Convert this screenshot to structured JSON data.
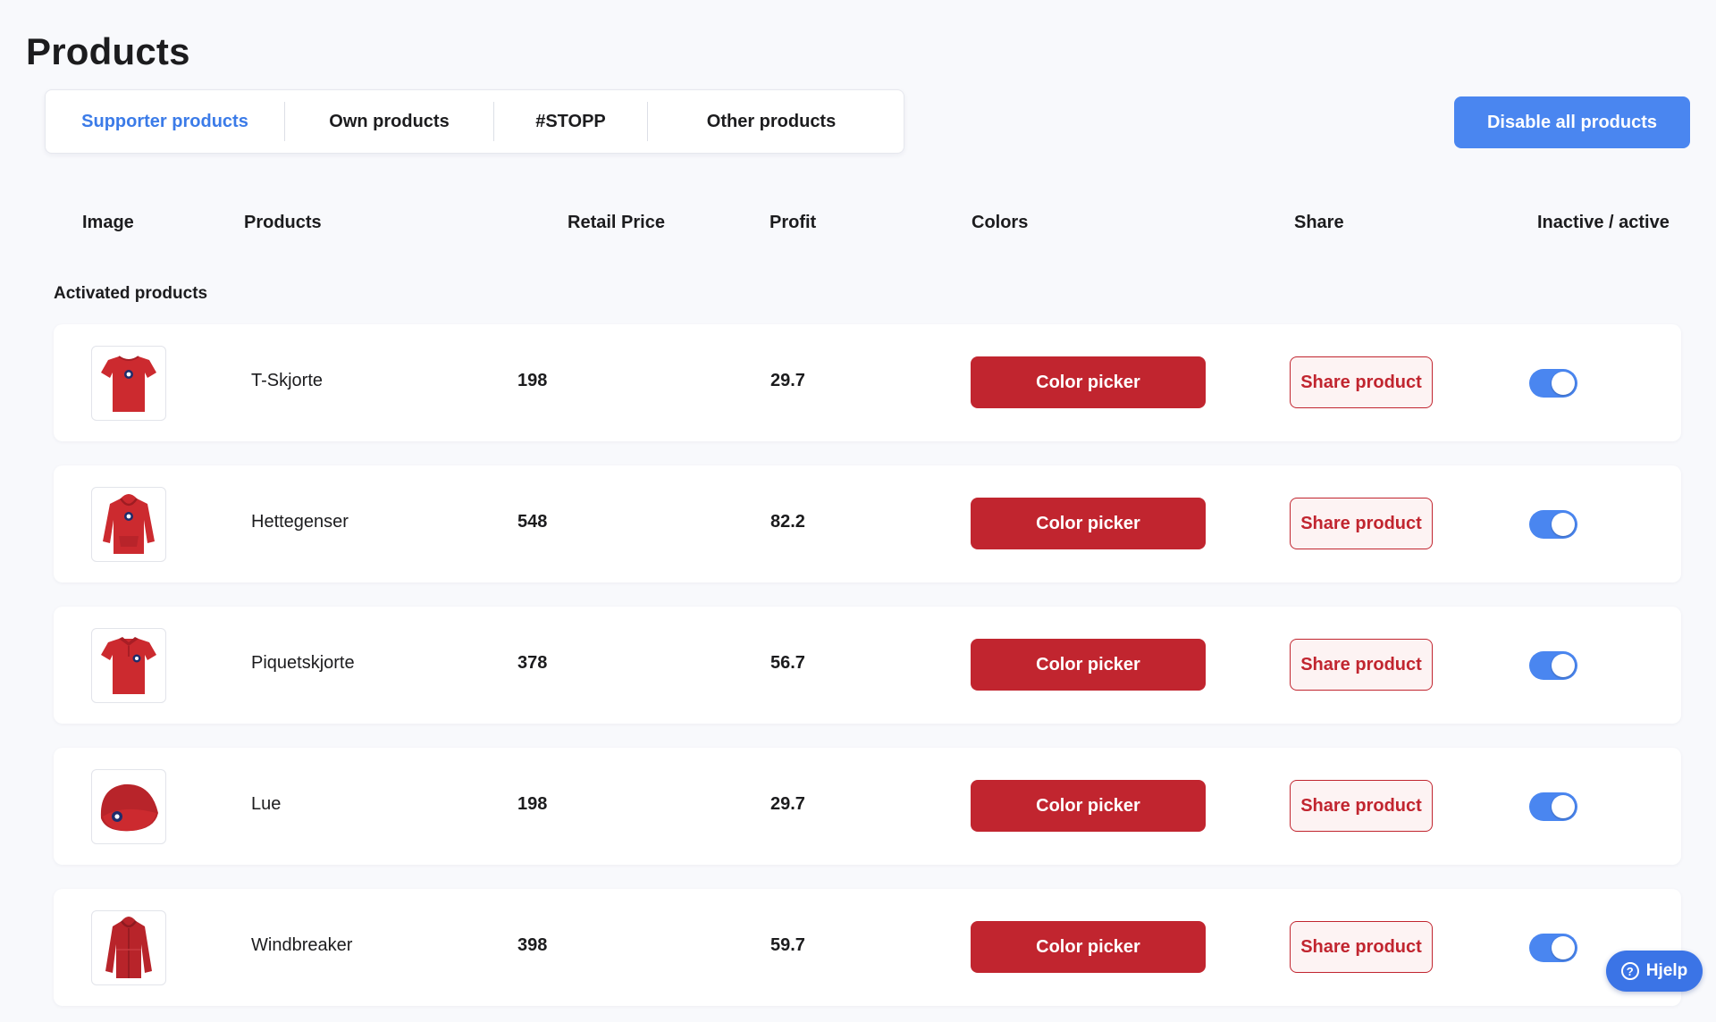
{
  "page": {
    "title": "Products"
  },
  "tabs": [
    {
      "label": "Supporter products",
      "active": true
    },
    {
      "label": "Own products",
      "active": false
    },
    {
      "label": "#STOPP",
      "active": false
    },
    {
      "label": "Other products",
      "active": false
    }
  ],
  "actions": {
    "disable_all": "Disable all products"
  },
  "columns": {
    "image": "Image",
    "products": "Products",
    "retail_price": "Retail Price",
    "profit": "Profit",
    "colors": "Colors",
    "share": "Share",
    "status": "Inactive / active"
  },
  "section": {
    "activated": "Activated products"
  },
  "products": [
    {
      "name": "T-Skjorte",
      "price": "198",
      "profit": "29.7",
      "color_label": "Color picker",
      "share_label": "Share product",
      "active": true,
      "icon": "t-shirt-icon"
    },
    {
      "name": "Hettegenser",
      "price": "548",
      "profit": "82.2",
      "color_label": "Color picker",
      "share_label": "Share product",
      "active": true,
      "icon": "hoodie-icon"
    },
    {
      "name": "Piquetskjorte",
      "price": "378",
      "profit": "56.7",
      "color_label": "Color picker",
      "share_label": "Share product",
      "active": true,
      "icon": "polo-shirt-icon"
    },
    {
      "name": "Lue",
      "price": "198",
      "profit": "29.7",
      "color_label": "Color picker",
      "share_label": "Share product",
      "active": true,
      "icon": "beanie-icon"
    },
    {
      "name": "Windbreaker",
      "price": "398",
      "profit": "59.7",
      "color_label": "Color picker",
      "share_label": "Share product",
      "active": true,
      "icon": "jacket-icon"
    }
  ],
  "help": {
    "label": "Hjelp",
    "icon": "question-circle-icon"
  },
  "colors": {
    "accent": "#4a86f0",
    "brand_red": "#c1252f",
    "product_red": "#cc2a2f"
  }
}
